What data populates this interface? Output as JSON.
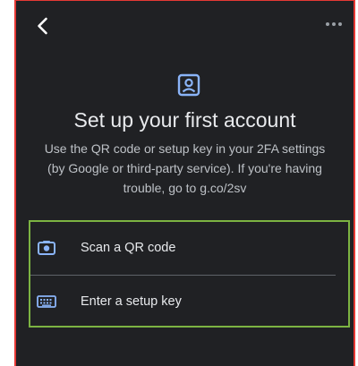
{
  "header": {
    "back_icon": "chevron-left-icon",
    "more_icon": "more-horizontal-icon",
    "account_icon": "account-box-icon"
  },
  "content": {
    "title": "Set up your first account",
    "description": "Use the QR code or setup key in your 2FA settings (by Google or third-party service). If you're having trouble, go to g.co/2sv"
  },
  "options": [
    {
      "label": "Scan a QR code",
      "icon": "camera-icon"
    },
    {
      "label": "Enter a setup key",
      "icon": "keyboard-icon"
    }
  ],
  "colors": {
    "background": "#202124",
    "accent": "#8ab4f8",
    "text": "#e8eaed",
    "secondary_text": "#bdc1c6",
    "highlight_border": "#7cb342",
    "frame_border": "#e53935"
  }
}
